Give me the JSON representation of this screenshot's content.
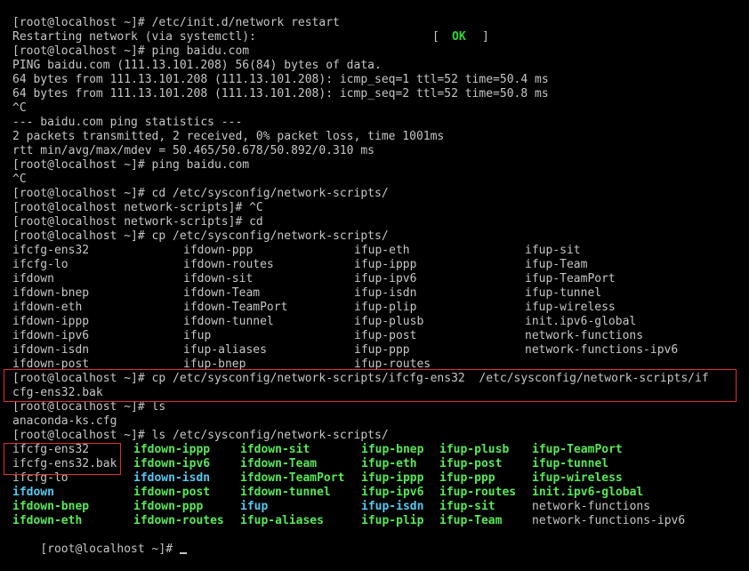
{
  "terminal": {
    "l1": "[root@localhost ~]# /etc/init.d/network restart",
    "l2a": "Restarting network (via systemctl):",
    "l2b_open": "[",
    "l2b_ok": "OK",
    "l2b_close": "]",
    "l3": "[root@localhost ~]# ping baidu.com",
    "l4": "PING baidu.com (111.13.101.208) 56(84) bytes of data.",
    "l5": "64 bytes from 111.13.101.208 (111.13.101.208): icmp_seq=1 ttl=52 time=50.4 ms",
    "l6": "64 bytes from 111.13.101.208 (111.13.101.208): icmp_seq=2 ttl=52 time=50.8 ms",
    "l7": "^C",
    "l8": "--- baidu.com ping statistics ---",
    "l9": "2 packets transmitted, 2 received, 0% packet loss, time 1001ms",
    "l10": "rtt min/avg/max/mdev = 50.465/50.678/50.892/0.310 ms",
    "l11": "[root@localhost ~]# ping baidu.com",
    "l12": "^C",
    "l13": "[root@localhost ~]# cd /etc/sysconfig/network-scripts/",
    "l14": "[root@localhost network-scripts]# ^C",
    "l15": "[root@localhost network-scripts]# cd",
    "l16": "[root@localhost ~]# cp /etc/sysconfig/network-scripts/",
    "l26": "[root@localhost ~]# cp /etc/sysconfig/network-scripts/ifcfg-ens32  /etc/sysconfig/network-scripts/if",
    "l27": "cfg-ens32.bak",
    "l28": "[root@localhost ~]# ls",
    "l29": "anaconda-ks.cfg",
    "l30": "[root@localhost ~]# ls /etc/sysconfig/network-scripts/",
    "l37": "[root@localhost ~]# "
  },
  "completion_list": [
    [
      "ifcfg-ens32",
      "ifdown-ppp",
      "ifup-eth",
      "ifup-sit"
    ],
    [
      "ifcfg-lo",
      "ifdown-routes",
      "ifup-ippp",
      "ifup-Team"
    ],
    [
      "ifdown",
      "ifdown-sit",
      "ifup-ipv6",
      "ifup-TeamPort"
    ],
    [
      "ifdown-bnep",
      "ifdown-Team",
      "ifup-isdn",
      "ifup-tunnel"
    ],
    [
      "ifdown-eth",
      "ifdown-TeamPort",
      "ifup-plip",
      "ifup-wireless"
    ],
    [
      "ifdown-ippp",
      "ifdown-tunnel",
      "ifup-plusb",
      "init.ipv6-global"
    ],
    [
      "ifdown-ipv6",
      "ifup",
      "ifup-post",
      "network-functions"
    ],
    [
      "ifdown-isdn",
      "ifup-aliases",
      "ifup-ppp",
      "network-functions-ipv6"
    ],
    [
      "ifdown-post",
      "ifup-bnep",
      "ifup-routes",
      ""
    ]
  ],
  "ls_output": [
    [
      [
        "ifcfg-ens32",
        "gray"
      ],
      [
        "ifdown-ippp",
        "green"
      ],
      [
        "ifdown-sit",
        "green"
      ],
      [
        "ifup-bnep",
        "green"
      ],
      [
        "ifup-plusb",
        "green"
      ],
      [
        "ifup-TeamPort",
        "green"
      ]
    ],
    [
      [
        "ifcfg-ens32.bak",
        "gray"
      ],
      [
        "ifdown-ipv6",
        "green"
      ],
      [
        "ifdown-Team",
        "green"
      ],
      [
        "ifup-eth",
        "green"
      ],
      [
        "ifup-post",
        "green"
      ],
      [
        "ifup-tunnel",
        "green"
      ]
    ],
    [
      [
        "ifcfg-lo",
        "gray"
      ],
      [
        "ifdown-isdn",
        "cyan"
      ],
      [
        "ifdown-TeamPort",
        "green"
      ],
      [
        "ifup-ippp",
        "green"
      ],
      [
        "ifup-ppp",
        "green"
      ],
      [
        "ifup-wireless",
        "green"
      ]
    ],
    [
      [
        "ifdown",
        "cyan"
      ],
      [
        "ifdown-post",
        "green"
      ],
      [
        "ifdown-tunnel",
        "green"
      ],
      [
        "ifup-ipv6",
        "green"
      ],
      [
        "ifup-routes",
        "green"
      ],
      [
        "init.ipv6-global",
        "green"
      ]
    ],
    [
      [
        "ifdown-bnep",
        "green"
      ],
      [
        "ifdown-ppp",
        "green"
      ],
      [
        "ifup",
        "cyan"
      ],
      [
        "ifup-isdn",
        "cyan"
      ],
      [
        "ifup-sit",
        "green"
      ],
      [
        "network-functions",
        "gray"
      ]
    ],
    [
      [
        "ifdown-eth",
        "green"
      ],
      [
        "ifdown-routes",
        "green"
      ],
      [
        "ifup-aliases",
        "green"
      ],
      [
        "ifup-plip",
        "green"
      ],
      [
        "ifup-Team",
        "green"
      ],
      [
        "network-functions-ipv6",
        "gray"
      ]
    ]
  ],
  "colors": {
    "background": "#000000",
    "foreground": "#c6c6c6",
    "executable": "#58e858",
    "symlink": "#56c8f0",
    "ok": "#38d438",
    "highlight_box": "#e03030"
  }
}
